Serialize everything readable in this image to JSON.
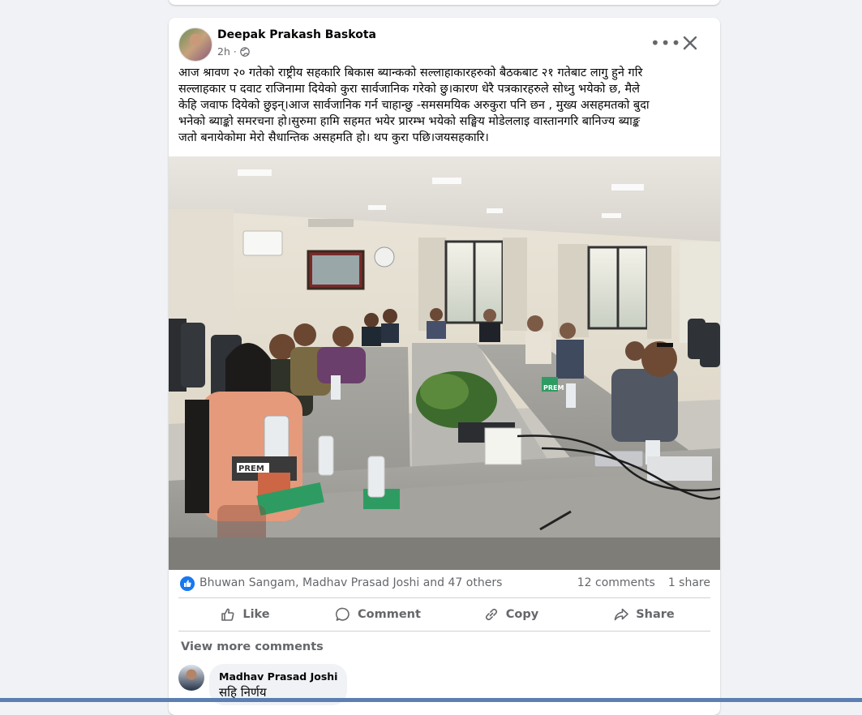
{
  "post": {
    "author": "Deepak Prakash Baskota",
    "time": "2h ·",
    "audience_icon": "globe-icon",
    "text_lines": [
      "आज श्रावण २०  गतेको  राष्ट्रीय सहकारि बिकास ब्यान्कको सल्लाहाकारहरुको बैठकबाट २१  गतेबाट  लागु हुने गरि",
      "सल्लाहकार प दवाट राजिनामा दियेको कुरा सार्वजानिक  गरेको छु।कारण धेरै पत्रकारहरुले सोध्नु भयेको  छ,  मैले",
      "केहि जवाफ  दियेको छुइन्।आज सार्वजानिक गर्न चाहान्छु -समसमयिक अरुकुरा पनि छन ,  मुख्य असहमतको बुदा",
      "भनेको ब्याङ्को समरचना हो।सुरुमा हामि सहमत भयेर प्रारम्भ भयेको सङ्घिय मोडेललाइ वास्तानगरि बानिज्य ब्याङ्क",
      "जतो बनायेकोमा मेरो सैधान्तिक असहमति हो। थप कुरा पछि।जयसहकारि।"
    ]
  },
  "photo": {
    "water_bottle_label": "PREM",
    "water_bottle_label_2": "PREM"
  },
  "reactions": {
    "names": "Bhuwan Sangam, Madhav Prasad Joshi and 47 others",
    "comments": "12 comments",
    "shares": "1 share"
  },
  "actions": {
    "like": "Like",
    "comment": "Comment",
    "copy": "Copy",
    "share": "Share"
  },
  "comments": {
    "view_more": "View more comments",
    "items": [
      {
        "author": "Madhav Prasad Joshi",
        "text": "सहि निर्णय"
      }
    ]
  },
  "colors": {
    "accent": "#1877f2",
    "secondary_text": "#65676b",
    "page_bg": "#f0f2f5"
  }
}
